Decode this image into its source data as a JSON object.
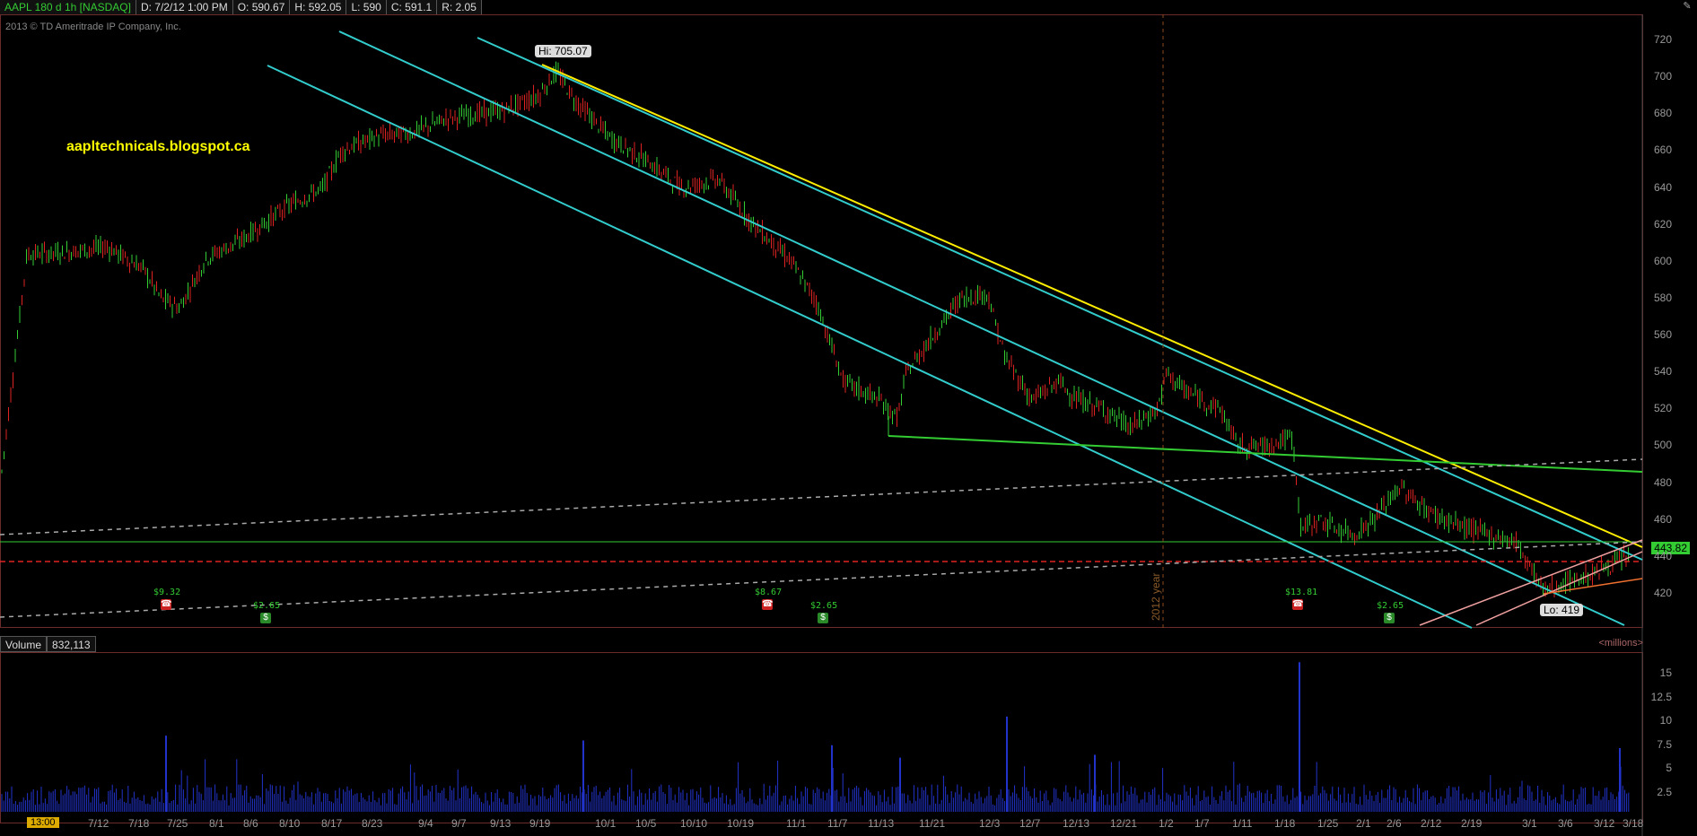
{
  "header": {
    "symbol": "AAPL 180 d 1h [NASDAQ]",
    "date": "D: 7/2/12 1:00 PM",
    "open": "O: 590.67",
    "high": "H: 592.05",
    "low": "L: 590",
    "close": "C: 591.1",
    "range": "R: 2.05"
  },
  "copyright": "2013 © TD Ameritrade IP Company, Inc.",
  "blog": "aapltechnicals.blogspot.ca",
  "hi_label": "Hi: 705.07",
  "lo_label": "Lo: 419",
  "current_price": "443.82",
  "year_marker": "2012 year",
  "price_axis": [
    "720",
    "700",
    "680",
    "660",
    "640",
    "620",
    "600",
    "580",
    "560",
    "540",
    "520",
    "500",
    "480",
    "460",
    "440",
    "420"
  ],
  "volume_panel": {
    "label": "Volume",
    "value": "832,113",
    "units": "<millions>"
  },
  "volume_axis": [
    "15",
    "12.5",
    "10",
    "7.5",
    "5",
    "2.5"
  ],
  "time_badge": "13:00",
  "x_axis": [
    "7/12",
    "7/18",
    "7/25",
    "8/1",
    "8/6",
    "8/10",
    "8/17",
    "8/23",
    "9/4",
    "9/7",
    "9/13",
    "9/19",
    "10/1",
    "10/5",
    "10/10",
    "10/19",
    "11/1",
    "11/7",
    "11/13",
    "11/21",
    "12/3",
    "12/7",
    "12/13",
    "12/21",
    "1/2",
    "1/7",
    "1/11",
    "1/18",
    "1/25",
    "2/1",
    "2/6",
    "2/12",
    "2/19",
    "3/1",
    "3/6",
    "3/12",
    "3/18"
  ],
  "events": [
    {
      "label": "$9.32",
      "kind": "earnings"
    },
    {
      "label": "$2.65",
      "kind": "dividend"
    },
    {
      "label": "$8.67",
      "kind": "earnings"
    },
    {
      "label": "$2.65",
      "kind": "dividend"
    },
    {
      "label": "$13.81",
      "kind": "earnings"
    },
    {
      "label": "$2.65",
      "kind": "dividend"
    }
  ],
  "colors": {
    "up_candle": "#33cc33",
    "down_candle": "#dd2222",
    "channel": "#33cccc",
    "yellow_trend": "#ffee00",
    "green_trend": "#33cc33",
    "volume": "#2233cc"
  }
}
